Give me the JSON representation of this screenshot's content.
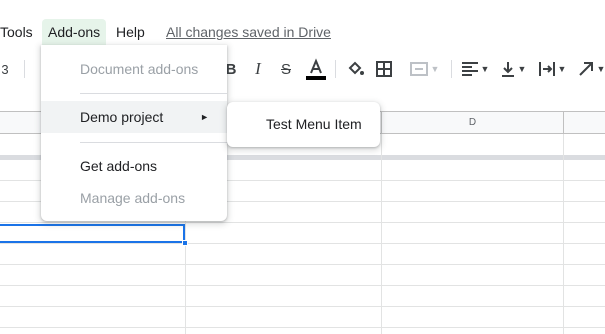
{
  "menubar": {
    "tools": "Tools",
    "addons": "Add-ons",
    "help": "Help",
    "saved_status": "All changes saved in Drive"
  },
  "toolbar": {
    "font_size_fragment": "3",
    "icons": [
      "bold-icon",
      "italic-icon",
      "strikethrough-icon",
      "text-color-icon",
      "fill-color-icon",
      "borders-icon",
      "merge-cells-icon",
      "align-left-icon",
      "vertical-align-icon",
      "text-wrap-icon",
      "text-rotation-icon"
    ]
  },
  "grid": {
    "column_headers": [
      "D"
    ]
  },
  "addons_menu": {
    "items": [
      {
        "label": "Document add-ons",
        "enabled": false
      },
      {
        "label": "Demo project",
        "has_submenu": true
      },
      {
        "label": "Get add-ons",
        "enabled": true
      },
      {
        "label": "Manage add-ons",
        "enabled": false
      }
    ],
    "submenu_arrow": "►",
    "submenu": {
      "items": [
        {
          "label": "Test Menu Item"
        }
      ]
    }
  },
  "colors": {
    "accent": "#1a73e8",
    "active_menu_bg": "#e6f4ea",
    "disabled_text": "#9aa0a6"
  }
}
